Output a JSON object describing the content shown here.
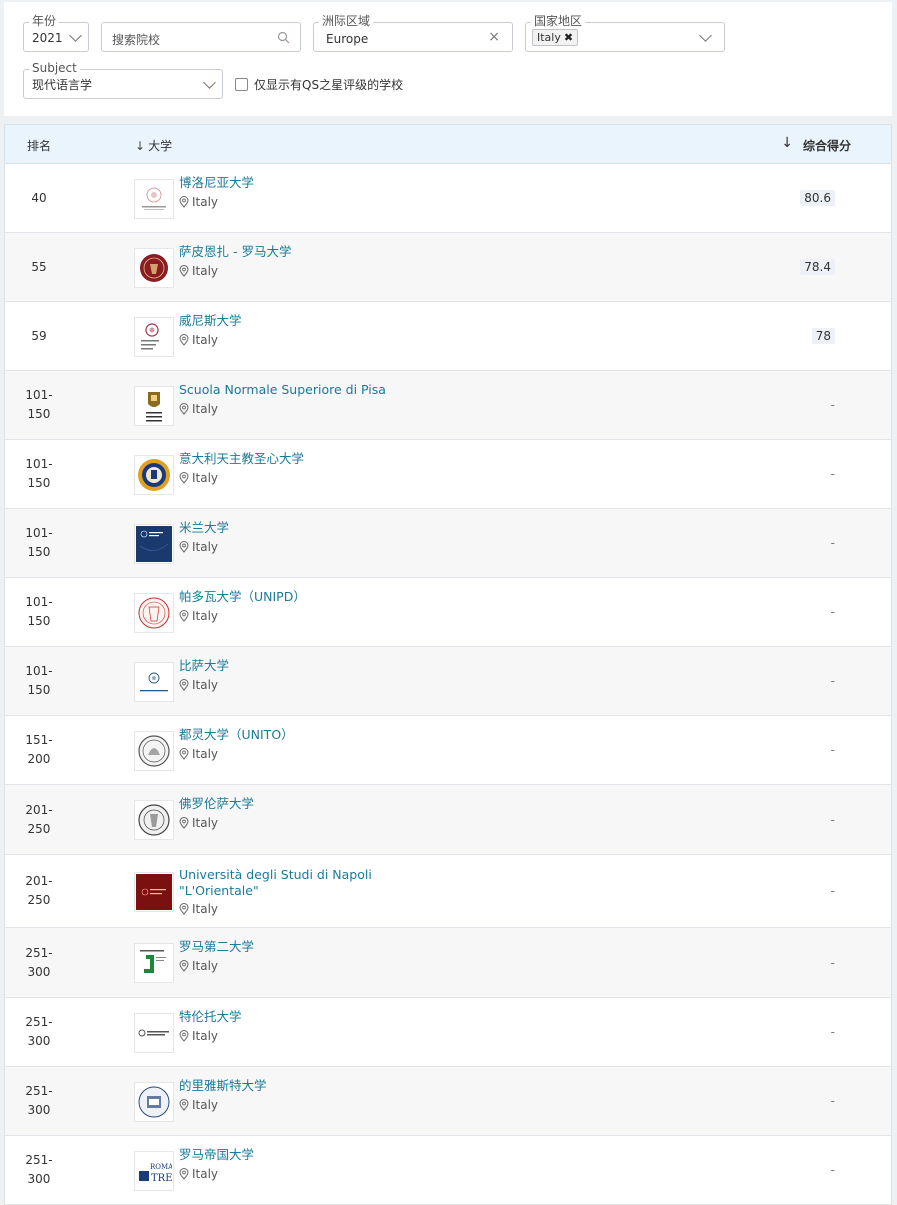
{
  "filters": {
    "year": {
      "legend": "年份",
      "value": "2021"
    },
    "search": {
      "placeholder": "搜索院校"
    },
    "region": {
      "legend": "洲际区域",
      "value": "Europe",
      "clear": "×"
    },
    "country": {
      "legend": "国家地区",
      "chip": "Italy",
      "chip_remove": "✖"
    },
    "subject": {
      "legend": "Subject",
      "value": "现代语言学"
    },
    "qs_stars_only": {
      "label": "仅显示有QS之星评级的学校",
      "checked": false
    }
  },
  "table": {
    "headers": {
      "rank": "排名",
      "university_arrow": "↓",
      "university": "大学",
      "score_arrow": "↓",
      "score": "综合得分"
    },
    "rows": [
      {
        "rank_1": "40",
        "rank_2": "",
        "name": "博洛尼亚大学",
        "country": "Italy",
        "score": "80.6",
        "logo": "bologna-seal",
        "logo_color": "#b04040"
      },
      {
        "rank_1": "55",
        "rank_2": "",
        "name": "萨皮恩扎 - 罗马大学",
        "country": "Italy",
        "score": "78.4",
        "logo": "sapienza-seal",
        "logo_color": "#8a1c24"
      },
      {
        "rank_1": "59",
        "rank_2": "",
        "name": "威尼斯大学",
        "country": "Italy",
        "score": "78",
        "logo": "ca-foscari",
        "logo_color": "#a0304a"
      },
      {
        "rank_1": "101-",
        "rank_2": "150",
        "name": "Scuola Normale Superiore di Pisa",
        "country": "Italy",
        "score": "-",
        "logo": "sns-crest",
        "logo_color": "#8a6a20"
      },
      {
        "rank_1": "101-",
        "rank_2": "150",
        "name": "意大利天主教圣心大学",
        "country": "Italy",
        "score": "-",
        "logo": "cattolica-seal",
        "logo_color": "#e0a020"
      },
      {
        "rank_1": "101-",
        "rank_2": "150",
        "name": "米兰大学",
        "country": "Italy",
        "score": "-",
        "logo": "milano-block",
        "logo_color": "#1a3a6e"
      },
      {
        "rank_1": "101-",
        "rank_2": "150",
        "name": "帕多瓦大学（UNIPD）",
        "country": "Italy",
        "score": "-",
        "logo": "padova-seal",
        "logo_color": "#c03030"
      },
      {
        "rank_1": "101-",
        "rank_2": "150",
        "name": "比萨大学",
        "country": "Italy",
        "score": "-",
        "logo": "pisa-cherub",
        "logo_color": "#2a5a8a"
      },
      {
        "rank_1": "151-",
        "rank_2": "200",
        "name": "都灵大学（UNITO）",
        "country": "Italy",
        "score": "-",
        "logo": "torino-seal",
        "logo_color": "#555555"
      },
      {
        "rank_1": "201-",
        "rank_2": "250",
        "name": "佛罗伦萨大学",
        "country": "Italy",
        "score": "-",
        "logo": "firenze-seal",
        "logo_color": "#444444"
      },
      {
        "rank_1": "201-",
        "rank_2": "250",
        "name": "Università degli Studi di Napoli \"L'Orientale\"",
        "country": "Italy",
        "score": "-",
        "logo": "orientale-block",
        "logo_color": "#7a1010"
      },
      {
        "rank_1": "251-",
        "rank_2": "300",
        "name": "罗马第二大学",
        "country": "Italy",
        "score": "-",
        "logo": "torvergata-mark",
        "logo_color": "#1a8a3a"
      },
      {
        "rank_1": "251-",
        "rank_2": "300",
        "name": "特伦托大学",
        "country": "Italy",
        "score": "-",
        "logo": "trento-wordmark",
        "logo_color": "#555555"
      },
      {
        "rank_1": "251-",
        "rank_2": "300",
        "name": "的里雅斯特大学",
        "country": "Italy",
        "score": "-",
        "logo": "trieste-seal",
        "logo_color": "#2a4a7a"
      },
      {
        "rank_1": "251-",
        "rank_2": "300",
        "name": "罗马帝国大学",
        "country": "Italy",
        "score": "-",
        "logo": "romatre-wordmark",
        "logo_color": "#1a3a7a"
      }
    ]
  }
}
